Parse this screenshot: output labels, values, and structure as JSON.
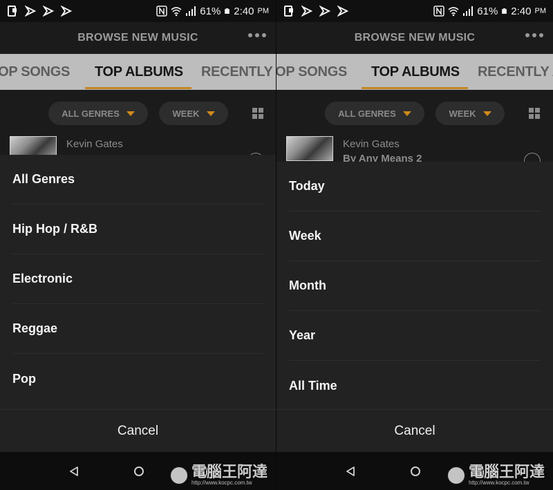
{
  "status_bar": {
    "battery": "61%",
    "time": "2:40",
    "ampm": "PM"
  },
  "header": {
    "title": "BROWSE NEW MUSIC"
  },
  "tabs": [
    "OP SONGS",
    "TOP ALBUMS",
    "RECENTLY A"
  ],
  "filters": {
    "genre": "ALL GENRES",
    "period": "WEEK"
  },
  "list_item": {
    "artist": "Kevin Gates",
    "album": "By Any Means 2"
  },
  "genre_menu": {
    "options": [
      "All Genres",
      "Hip Hop / R&B",
      "Electronic",
      "Reggae",
      "Pop"
    ],
    "cancel": "Cancel"
  },
  "period_menu": {
    "options": [
      "Today",
      "Week",
      "Month",
      "Year",
      "All Time"
    ],
    "cancel": "Cancel"
  },
  "watermark": {
    "logo": "電腦王阿達",
    "url": "http://www.kocpc.com.tw"
  },
  "colors": {
    "accent": "#c2861f",
    "tab_bar": "#bdbdbd",
    "sheet": "#222222",
    "background": "#1b1b1b"
  }
}
